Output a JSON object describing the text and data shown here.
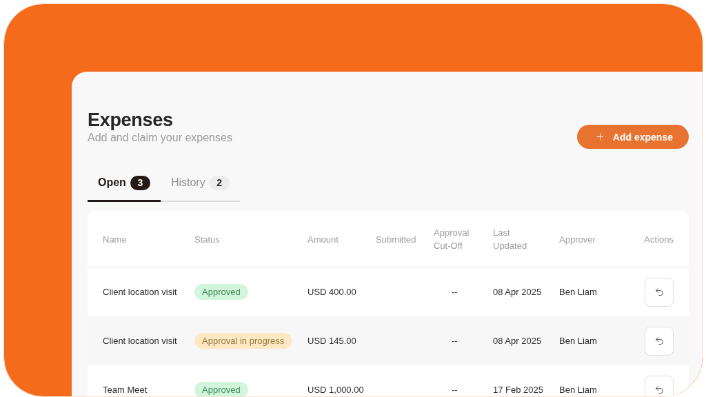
{
  "page": {
    "title": "Expenses",
    "subtitle": "Add and claim your expenses"
  },
  "add_button": {
    "label": "Add expense"
  },
  "tabs": [
    {
      "label": "Open",
      "count": "3",
      "selected": true
    },
    {
      "label": "History",
      "count": "2",
      "selected": false
    }
  ],
  "table": {
    "columns": [
      "Name",
      "Status",
      "Amount",
      "Submitted",
      "Approval Cut-Off",
      "Last Updated",
      "Approver",
      "Actions"
    ],
    "rows": [
      {
        "name": "Client location visit",
        "status": {
          "label": "Approved",
          "kind": "approved"
        },
        "amount": "USD 400.00",
        "cut_off": "--",
        "last_updated": "08 Apr 2025",
        "approver": "Ben Liam"
      },
      {
        "name": "Client location visit",
        "status": {
          "label": "Approval in progress",
          "kind": "in_progress"
        },
        "amount": "USD 145.00",
        "cut_off": "--",
        "last_updated": "08 Apr 2025",
        "approver": "Ben Liam"
      },
      {
        "name": "Team Meet",
        "status": {
          "label": "Approved",
          "kind": "approved"
        },
        "amount": "USD 1,000.00",
        "cut_off": "--",
        "last_updated": "17 Feb 2025",
        "approver": "Ben Liam"
      }
    ]
  }
}
